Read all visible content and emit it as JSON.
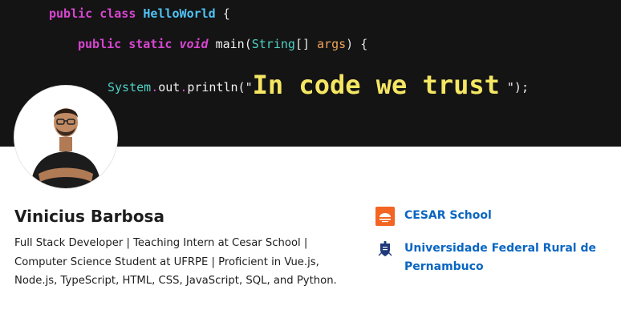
{
  "banner": {
    "line1": {
      "kw1": "public",
      "kw2": "class",
      "cls": "HelloWorld",
      "brace": "{"
    },
    "line2": {
      "kw1": "public",
      "kw2": "static",
      "void": "void",
      "fn": "main(",
      "type": "String",
      "brackets": "[]",
      "arg": "args",
      "end": ") {"
    },
    "line3": {
      "obj": "System",
      "dot1": ".",
      "out": "out",
      "dot2": ".",
      "fn": "println(\"",
      "big": "In code we trust",
      "end": "\");"
    }
  },
  "profile": {
    "name": "Vinicius Barbosa",
    "headline": "Full Stack Developer | Teaching Intern at Cesar School | Computer Science Student at UFRPE | Proficient in Vue.js, Node.js, TypeScript, HTML, CSS, JavaScript, SQL, and Python."
  },
  "organizations": [
    {
      "name": "CESAR School",
      "logo_icon": "cesar-school-logo-icon",
      "color": "#f26522"
    },
    {
      "name": "Universidade Federal Rural de Pernambuco",
      "logo_icon": "ufrpe-crest-icon",
      "color": "#1f3a7a"
    }
  ],
  "colors": {
    "link": "#0a66c2",
    "banner_bg": "#141414",
    "highlight": "#f5e663"
  }
}
